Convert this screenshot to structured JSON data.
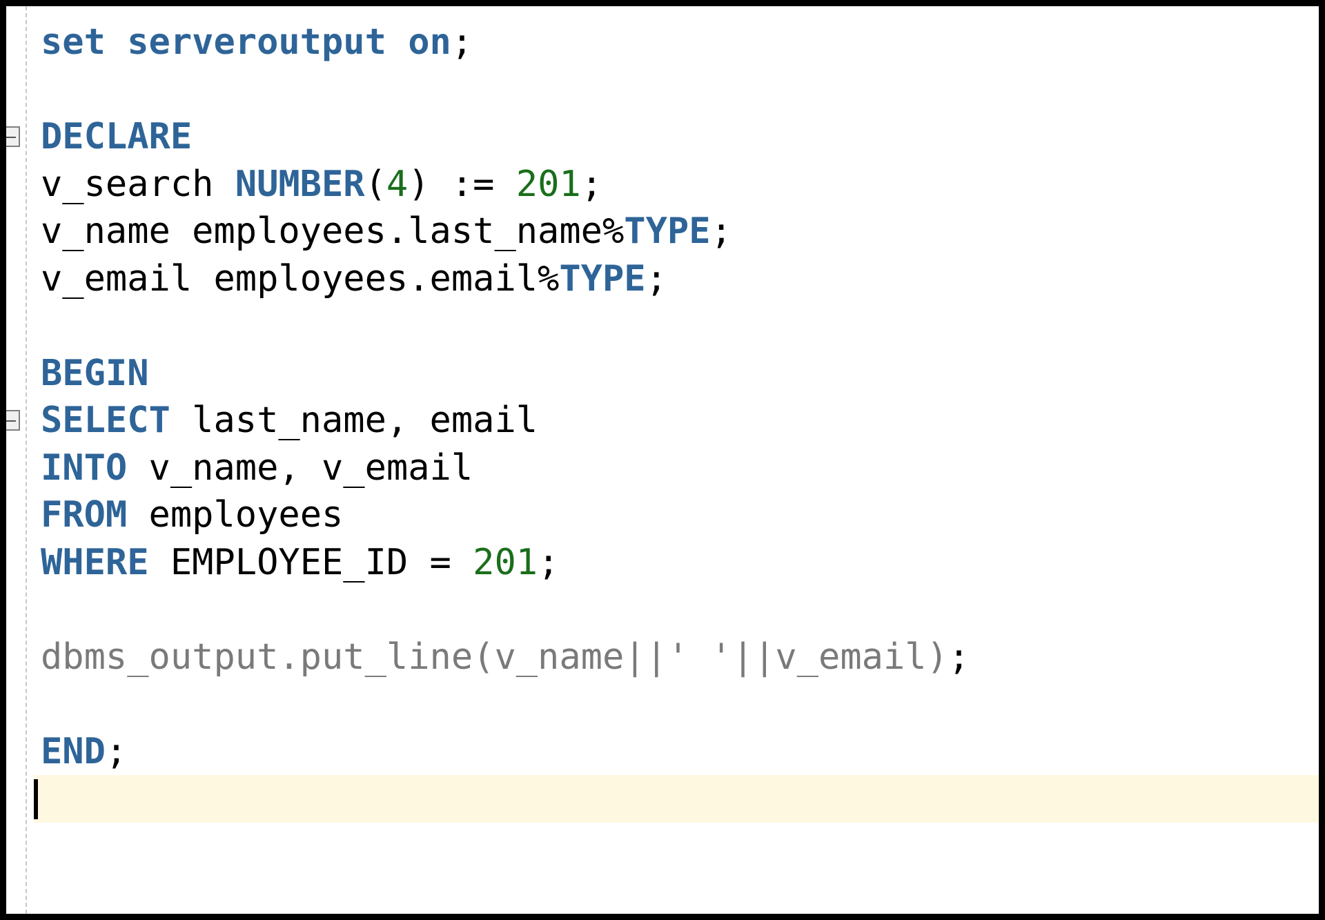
{
  "editor": {
    "lines": [
      [
        {
          "t": "set serveroutput on",
          "c": "kw"
        },
        {
          "t": ";",
          "c": "plain"
        }
      ],
      [],
      [
        {
          "t": "DECLARE",
          "c": "kw"
        }
      ],
      [
        {
          "t": "v_search ",
          "c": "plain"
        },
        {
          "t": "NUMBER",
          "c": "kw"
        },
        {
          "t": "(",
          "c": "plain"
        },
        {
          "t": "4",
          "c": "num"
        },
        {
          "t": ") := ",
          "c": "plain"
        },
        {
          "t": "201",
          "c": "num"
        },
        {
          "t": ";",
          "c": "plain"
        }
      ],
      [
        {
          "t": "v_name employees.last_name%",
          "c": "plain"
        },
        {
          "t": "TYPE",
          "c": "kw"
        },
        {
          "t": ";",
          "c": "plain"
        }
      ],
      [
        {
          "t": "v_email employees.email%",
          "c": "plain"
        },
        {
          "t": "TYPE",
          "c": "kw"
        },
        {
          "t": ";",
          "c": "plain"
        }
      ],
      [],
      [
        {
          "t": "BEGIN",
          "c": "kw"
        }
      ],
      [
        {
          "t": "SELECT",
          "c": "kw"
        },
        {
          "t": " last_name, email",
          "c": "plain"
        }
      ],
      [
        {
          "t": "INTO",
          "c": "kw"
        },
        {
          "t": " v_name, v_email",
          "c": "plain"
        }
      ],
      [
        {
          "t": "FROM",
          "c": "kw"
        },
        {
          "t": " employees",
          "c": "plain"
        }
      ],
      [
        {
          "t": "WHERE",
          "c": "kw"
        },
        {
          "t": " EMPLOYEE_ID = ",
          "c": "plain"
        },
        {
          "t": "201",
          "c": "num"
        },
        {
          "t": ";",
          "c": "plain"
        }
      ],
      [],
      [
        {
          "t": "dbms_output.put_line(v_name||' '||v_email)",
          "c": "muted"
        },
        {
          "t": ";",
          "c": "plain"
        }
      ],
      [],
      [
        {
          "t": "END",
          "c": "kw"
        },
        {
          "t": ";",
          "c": "plain"
        }
      ],
      []
    ],
    "fold_markers": [
      2,
      8
    ],
    "current_line": 16
  },
  "colors": {
    "keyword": "#2e6498",
    "number": "#1a6e1a",
    "muted": "#7a7a7a",
    "current_line_bg": "#fff8e1"
  }
}
